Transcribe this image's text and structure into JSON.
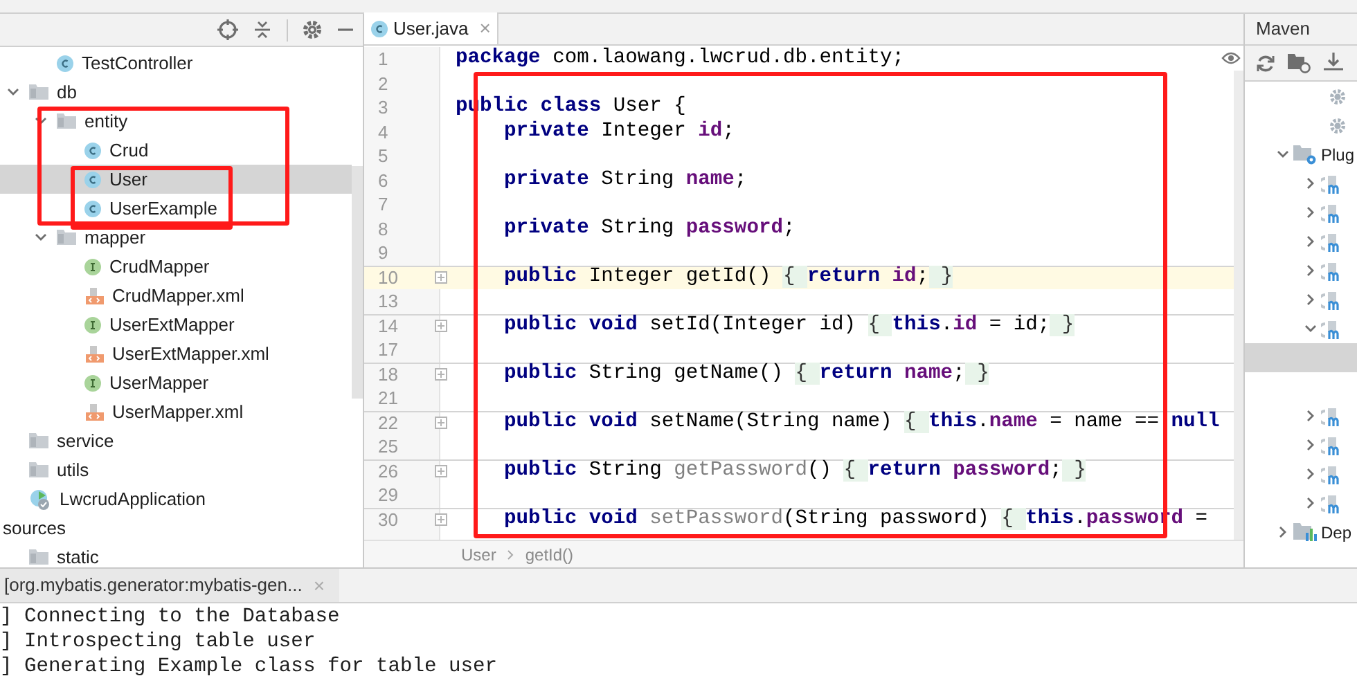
{
  "project_tree": [
    {
      "children": [
        {
          "children": [
            {
              "label": "TestController",
              "kind": "class",
              "selected": false
            }
          ]
        },
        {
          "label": "db",
          "kind": "folder",
          "expanded": true,
          "selected": false,
          "children": [
            {
              "label": "entity",
              "kind": "folder",
              "expanded": true,
              "selected": false,
              "children": [
                {
                  "label": "Crud",
                  "kind": "class",
                  "selected": false
                },
                {
                  "label": "User",
                  "kind": "class",
                  "selected": true
                },
                {
                  "label": "UserExample",
                  "kind": "class",
                  "selected": false
                }
              ]
            },
            {
              "label": "mapper",
              "kind": "folder",
              "expanded": true,
              "selected": false,
              "children": [
                {
                  "label": "CrudMapper",
                  "kind": "interface",
                  "selected": false
                },
                {
                  "label": "CrudMapper.xml",
                  "kind": "xml",
                  "selected": false
                },
                {
                  "label": "UserExtMapper",
                  "kind": "interface",
                  "selected": false
                },
                {
                  "label": "UserExtMapper.xml",
                  "kind": "xml",
                  "selected": false
                },
                {
                  "label": "UserMapper",
                  "kind": "interface",
                  "selected": false
                },
                {
                  "label": "UserMapper.xml",
                  "kind": "xml",
                  "selected": false
                }
              ]
            }
          ]
        },
        {
          "label": "service",
          "kind": "folder",
          "selected": false
        },
        {
          "label": "utils",
          "kind": "folder",
          "selected": false
        },
        {
          "label": "LwcrudApplication",
          "kind": "app",
          "selected": false
        }
      ]
    },
    {
      "label": "sources",
      "selected": false,
      "children": [
        {
          "label": "static",
          "kind": "folder",
          "selected": false
        }
      ]
    }
  ],
  "editor": {
    "tab": {
      "label": "User.java",
      "close": "×"
    },
    "lines": [
      {
        "number": "1",
        "current": false,
        "separator": false,
        "tokens": [
          {
            "text": "package",
            "kind": "kw"
          },
          {
            "text": " com.laowang.lwcrud.db.entity;",
            "kind": "plain"
          }
        ]
      },
      {
        "number": "2",
        "current": false,
        "separator": false
      },
      {
        "number": "3",
        "current": false,
        "separator": false,
        "tokens": [
          {
            "text": "public class",
            "kind": "kw"
          },
          {
            "text": " User {",
            "kind": "plain"
          }
        ]
      },
      {
        "number": "4",
        "current": false,
        "separator": false,
        "tokens": [
          {
            "text": "    private",
            "kind": "kw"
          },
          {
            "text": " Integer ",
            "kind": "plain"
          },
          {
            "text": "id",
            "kind": "field"
          },
          {
            "text": ";",
            "kind": "plain"
          }
        ]
      },
      {
        "number": "5",
        "current": false,
        "separator": false
      },
      {
        "number": "6",
        "current": false,
        "separator": false,
        "tokens": [
          {
            "text": "    private",
            "kind": "kw"
          },
          {
            "text": " String ",
            "kind": "plain"
          },
          {
            "text": "name",
            "kind": "field"
          },
          {
            "text": ";",
            "kind": "plain"
          }
        ]
      },
      {
        "number": "7",
        "current": false,
        "separator": false
      },
      {
        "number": "8",
        "current": false,
        "separator": false,
        "tokens": [
          {
            "text": "    private",
            "kind": "kw"
          },
          {
            "text": " String ",
            "kind": "plain"
          },
          {
            "text": "password",
            "kind": "field"
          },
          {
            "text": ";",
            "kind": "plain"
          }
        ]
      },
      {
        "number": "9",
        "current": false,
        "separator": false
      },
      {
        "number": "10",
        "current": true,
        "separator": true,
        "tokens": [
          {
            "text": "    public",
            "kind": "kw"
          },
          {
            "text": " Integer getId() ",
            "kind": "plain"
          },
          {
            "text": "{ ",
            "kind": "fold"
          },
          {
            "text": "return",
            "kind": "kw"
          },
          {
            "text": " id",
            "kind": "field"
          },
          {
            "text": ";",
            "kind": "plain"
          },
          {
            "text": " }",
            "kind": "fold"
          }
        ]
      },
      {
        "number": "13",
        "current": false,
        "separator": false
      },
      {
        "number": "14",
        "current": false,
        "separator": true,
        "tokens": [
          {
            "text": "    public void",
            "kind": "kw"
          },
          {
            "text": " setId(Integer id) ",
            "kind": "plain"
          },
          {
            "text": "{ ",
            "kind": "fold"
          },
          {
            "text": "this",
            "kind": "kw"
          },
          {
            "text": ".",
            "kind": "plain"
          },
          {
            "text": "id",
            "kind": "field"
          },
          {
            "text": " = id;",
            "kind": "plain"
          },
          {
            "text": " }",
            "kind": "fold"
          }
        ]
      },
      {
        "number": "17",
        "current": false,
        "separator": false
      },
      {
        "number": "18",
        "current": false,
        "separator": true,
        "tokens": [
          {
            "text": "    public",
            "kind": "kw"
          },
          {
            "text": " String getName() ",
            "kind": "plain"
          },
          {
            "text": "{ ",
            "kind": "fold"
          },
          {
            "text": "return",
            "kind": "kw"
          },
          {
            "text": " name",
            "kind": "field"
          },
          {
            "text": ";",
            "kind": "plain"
          },
          {
            "text": " }",
            "kind": "fold"
          }
        ]
      },
      {
        "number": "21",
        "current": false,
        "separator": false
      },
      {
        "number": "22",
        "current": false,
        "separator": true,
        "tokens": [
          {
            "text": "    public void",
            "kind": "kw"
          },
          {
            "text": " setName(String name) ",
            "kind": "plain"
          },
          {
            "text": "{ ",
            "kind": "fold"
          },
          {
            "text": "this",
            "kind": "kw"
          },
          {
            "text": ".",
            "kind": "plain"
          },
          {
            "text": "name",
            "kind": "field"
          },
          {
            "text": " = name == ",
            "kind": "plain"
          },
          {
            "text": "null",
            "kind": "kw"
          }
        ]
      },
      {
        "number": "25",
        "current": false,
        "separator": false
      },
      {
        "number": "26",
        "current": false,
        "separator": true,
        "tokens": [
          {
            "text": "    public",
            "kind": "kw"
          },
          {
            "text": " String ",
            "kind": "plain"
          },
          {
            "text": "getPassword",
            "kind": "unused"
          },
          {
            "text": "() ",
            "kind": "plain"
          },
          {
            "text": "{ ",
            "kind": "fold"
          },
          {
            "text": "return",
            "kind": "kw"
          },
          {
            "text": " password",
            "kind": "field"
          },
          {
            "text": ";",
            "kind": "plain"
          },
          {
            "text": " }",
            "kind": "fold"
          }
        ]
      },
      {
        "number": "29",
        "current": false,
        "separator": false
      },
      {
        "number": "30",
        "current": false,
        "separator": true,
        "tokens": [
          {
            "text": "    public void",
            "kind": "kw"
          },
          {
            "text": " setPassword",
            "kind": "unused"
          },
          {
            "text": "(String password) ",
            "kind": "plain"
          },
          {
            "text": "{ ",
            "kind": "fold"
          },
          {
            "text": "this",
            "kind": "kw"
          },
          {
            "text": ".",
            "kind": "plain"
          },
          {
            "text": "password",
            "kind": "field"
          },
          {
            "text": " =",
            "kind": "plain"
          }
        ]
      }
    ],
    "breadcrumbs": [
      "User",
      "getId()"
    ]
  },
  "maven": {
    "title": "Maven",
    "items": [
      {
        "kind": "goal",
        "selected": false
      },
      {
        "kind": "goal",
        "selected": false
      },
      {
        "kind": "plugins",
        "label": "Plug",
        "expanded": true,
        "selected": false,
        "plugins": [
          {
            "expanded": false,
            "selected": false
          },
          {
            "expanded": false,
            "selected": false
          },
          {
            "expanded": false,
            "selected": false
          },
          {
            "expanded": false,
            "selected": false
          },
          {
            "expanded": false,
            "selected": false
          },
          {
            "expanded": true,
            "selected": false,
            "goals": [
              {
                "selected": true
              },
              {
                "selected": false
              }
            ]
          },
          {
            "expanded": false,
            "selected": false
          },
          {
            "expanded": false,
            "selected": false
          },
          {
            "expanded": false,
            "selected": false
          },
          {
            "expanded": false,
            "selected": false
          }
        ]
      },
      {
        "kind": "dependencies",
        "label": "Dep",
        "expanded": false,
        "selected": false
      }
    ]
  },
  "run_panel": {
    "tab": {
      "label": "[org.mybatis.generator:mybatis-gen...",
      "close": "×"
    },
    "lines": [
      "] Connecting to the Database",
      "] Introspecting table user",
      "] Generating Example class for table user"
    ]
  }
}
